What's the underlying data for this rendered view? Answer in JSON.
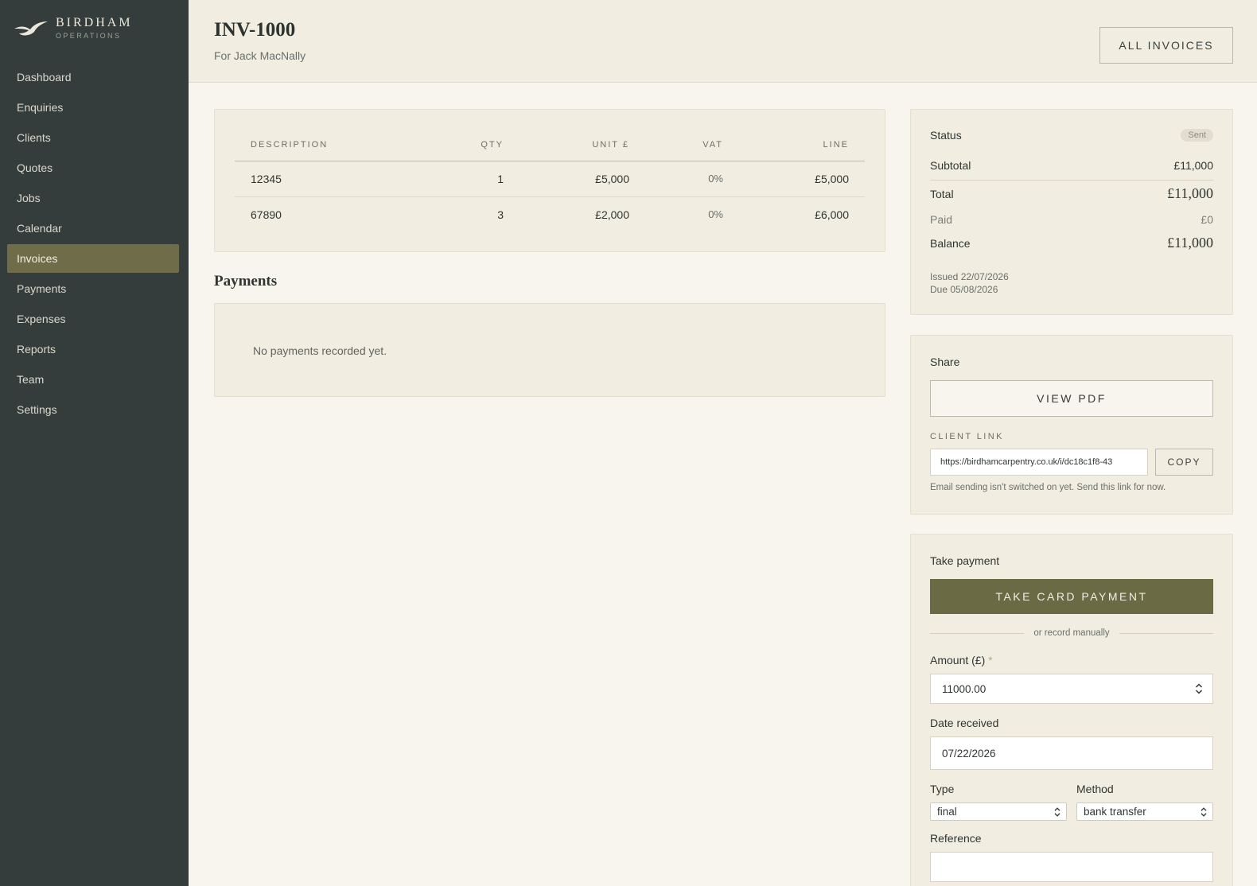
{
  "brand": {
    "name": "BIRDHAM",
    "sub": "OPERATIONS",
    "icon": "bird-logo-icon"
  },
  "nav": {
    "items": [
      {
        "label": "Dashboard",
        "active": false
      },
      {
        "label": "Enquiries",
        "active": false
      },
      {
        "label": "Clients",
        "active": false
      },
      {
        "label": "Quotes",
        "active": false
      },
      {
        "label": "Jobs",
        "active": false
      },
      {
        "label": "Calendar",
        "active": false
      },
      {
        "label": "Invoices",
        "active": true
      },
      {
        "label": "Payments",
        "active": false
      },
      {
        "label": "Expenses",
        "active": false
      },
      {
        "label": "Reports",
        "active": false
      },
      {
        "label": "Team",
        "active": false
      },
      {
        "label": "Settings",
        "active": false
      }
    ]
  },
  "header": {
    "title": "INV-1000",
    "subtitle": "For Jack MacNally",
    "all_invoices": "ALL INVOICES"
  },
  "lines": {
    "headers": [
      "DESCRIPTION",
      "QTY",
      "UNIT £",
      "VAT",
      "LINE"
    ],
    "rows": [
      [
        "12345",
        "1",
        "£5,000",
        "0%",
        "£5,000"
      ],
      [
        "67890",
        "3",
        "£2,000",
        "0%",
        "£6,000"
      ]
    ]
  },
  "payments": {
    "title": "Payments",
    "empty": "No payments recorded yet."
  },
  "summary": {
    "status_label": "Status",
    "status_value": "Sent",
    "subtotal_label": "Subtotal",
    "subtotal_value": "£11,000",
    "total_label": "Total",
    "total_value": "£11,000",
    "paid_label": "Paid",
    "paid_value": "£0",
    "balance_label": "Balance",
    "balance_value": "£11,000",
    "issued": "Issued 22/07/2026",
    "due": "Due 05/08/2026"
  },
  "share": {
    "title": "Share",
    "view_pdf": "VIEW PDF",
    "client_link_label": "CLIENT LINK",
    "link": "https://birdhamcarpentry.co.uk/i/dc18c1f8-43",
    "copy": "COPY",
    "note": "Email sending isn't switched on yet. Send this link for now."
  },
  "take_payment": {
    "title": "Take payment",
    "card_button": "TAKE CARD PAYMENT",
    "or_text": "or record manually",
    "amount_label": "Amount (£)",
    "required_mark": "*",
    "amount_value": "11000.00",
    "date_label": "Date received",
    "date_value": "07/22/2026",
    "type_label": "Type",
    "type_value": "final",
    "method_label": "Method",
    "method_value": "bank transfer",
    "reference_label": "Reference",
    "reference_value": ""
  },
  "colors": {
    "sidebar": "#343d3b",
    "accent": "#6a6a45",
    "active_nav": "#6f6c4a",
    "page_bg": "#f8f5ee",
    "card_bg": "#f2ede1"
  }
}
